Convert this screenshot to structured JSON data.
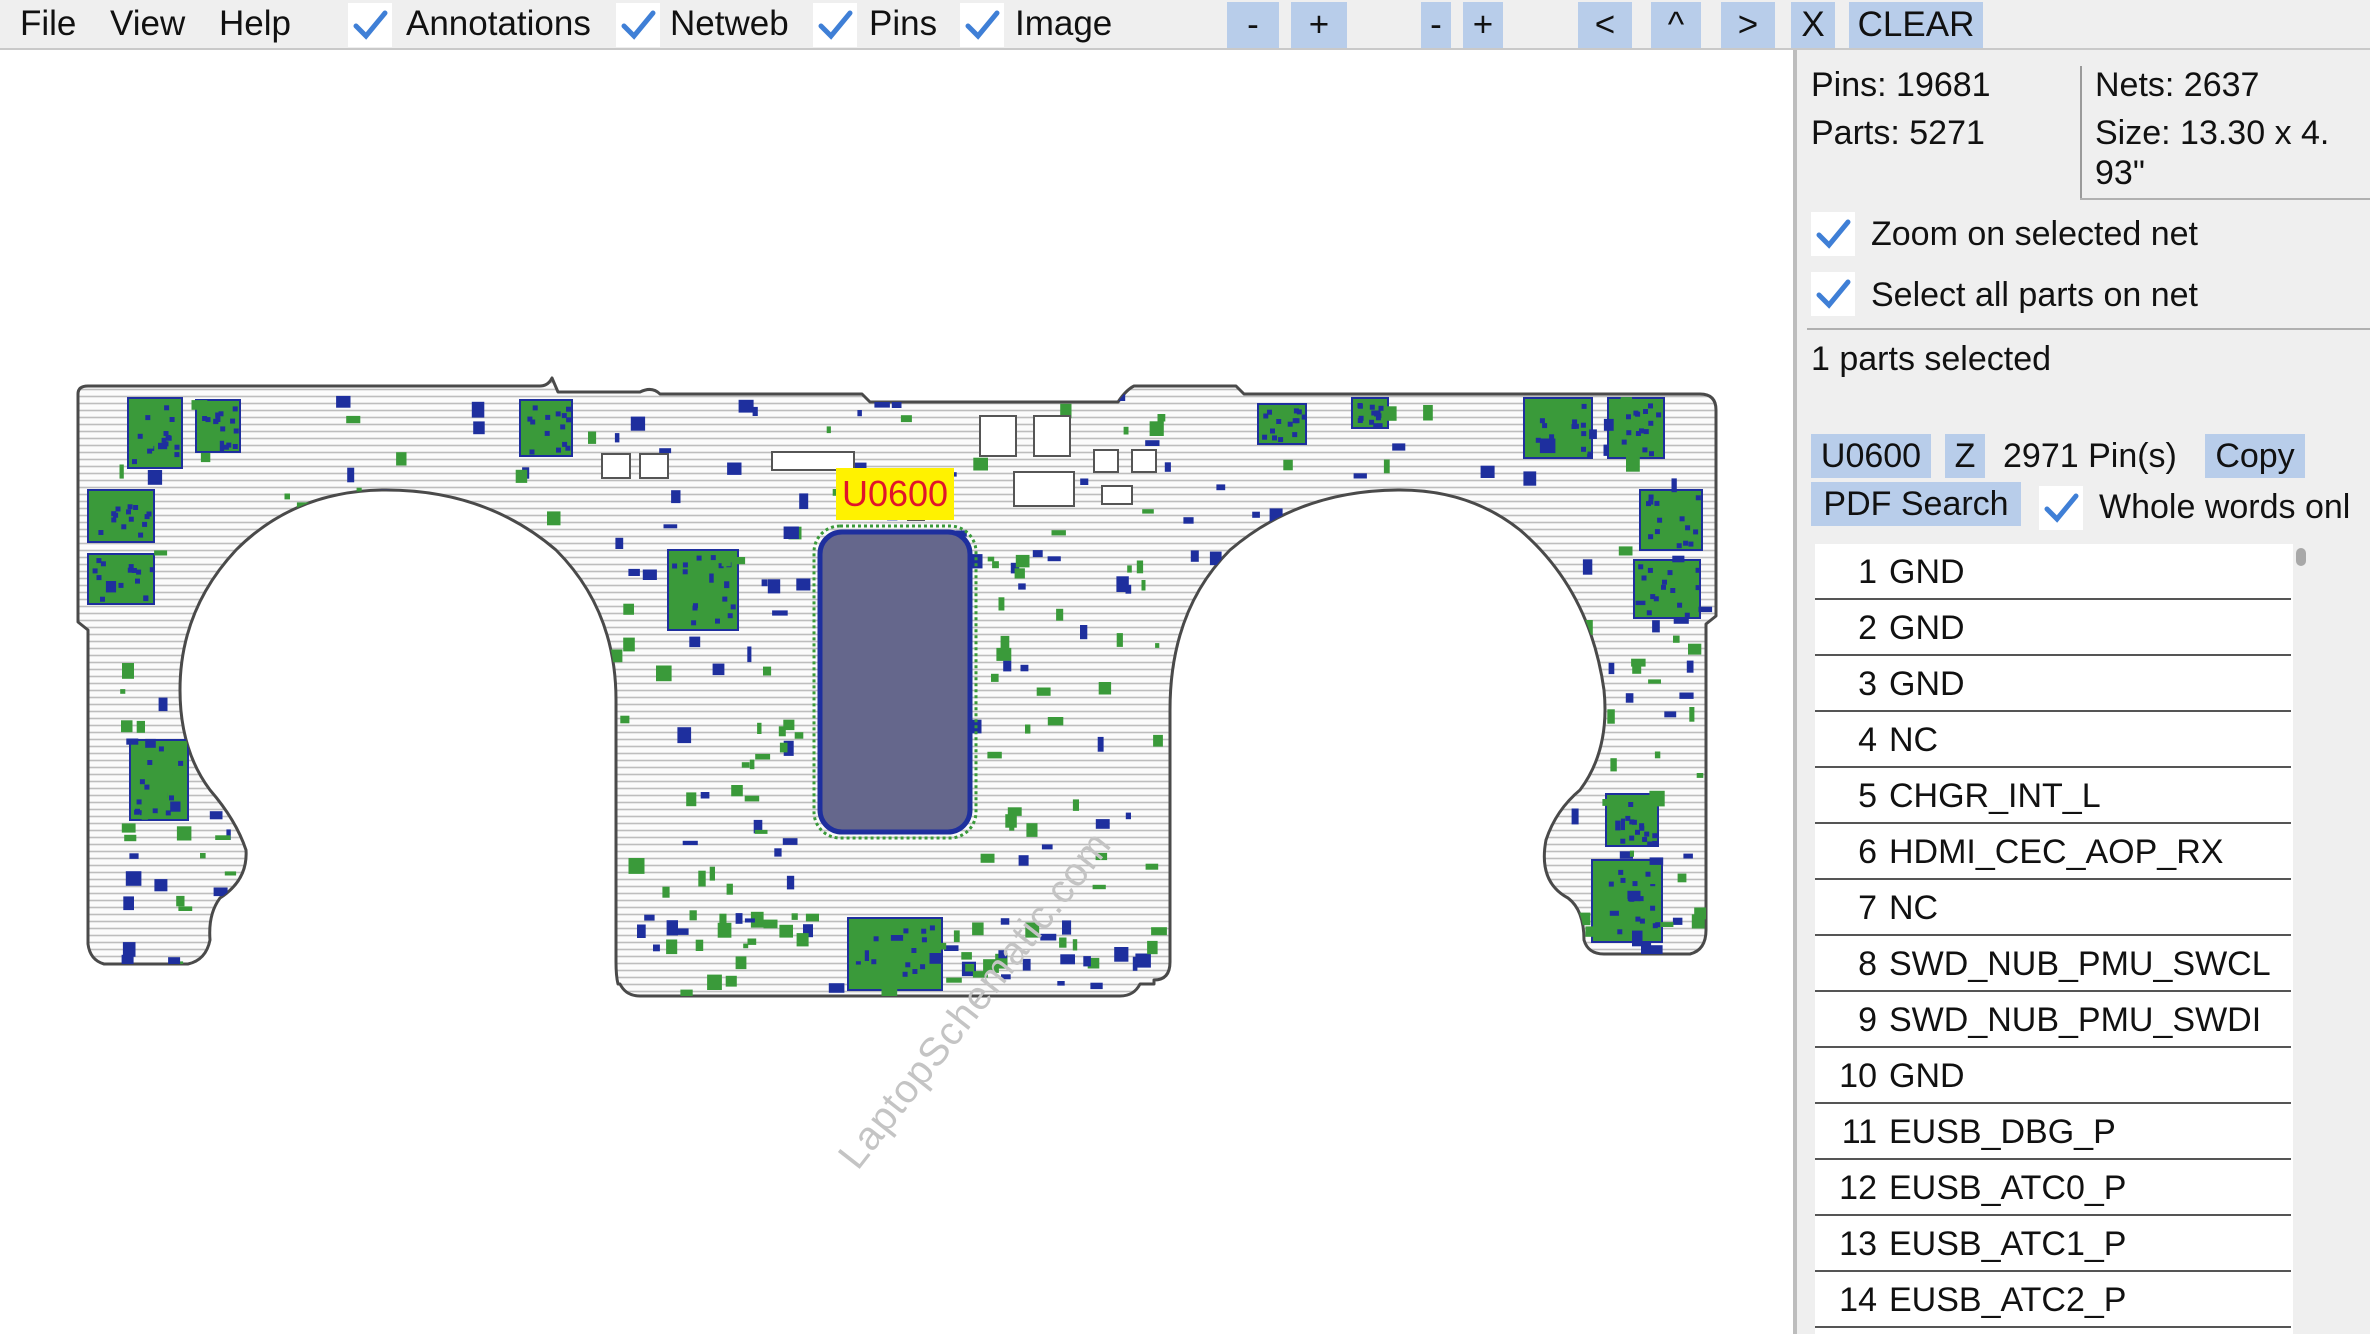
{
  "menu": {
    "file": "File",
    "view": "View",
    "help": "Help"
  },
  "toggles": [
    {
      "label": "Annotations",
      "checked": true
    },
    {
      "label": "Netweb",
      "checked": true
    },
    {
      "label": "Pins",
      "checked": true
    },
    {
      "label": "Image",
      "checked": true
    }
  ],
  "toolbar": {
    "zoom_out_1": "-",
    "zoom_in_1": "+",
    "zoom_out_2": "-",
    "zoom_in_2": "+",
    "prev": "<",
    "up": "^",
    "next": ">",
    "close": "X",
    "clear": "CLEAR"
  },
  "board": {
    "selected_part_label": "U0600",
    "watermark": "LaptopSchematic.com"
  },
  "panel": {
    "pins": "Pins: 19681",
    "parts": "Parts: 5271",
    "nets": "Nets: 2637",
    "size_line1": "Size: 13.30 x 4.",
    "size_line2": "93\"",
    "zoom_on_net": {
      "label": "Zoom on selected net",
      "checked": true
    },
    "select_all_on_net": {
      "label": "Select all parts on net",
      "checked": true
    },
    "selection_status": "1 parts selected",
    "part_button": "U0600",
    "z_button": "Z",
    "pin_count": "2971 Pin(s)",
    "copy_button": "Copy",
    "pdf_search_button": "PDF Search",
    "whole_words": {
      "label": "Whole words onl",
      "checked": true
    }
  },
  "pin_list": [
    {
      "num": "1",
      "net": "GND"
    },
    {
      "num": "2",
      "net": "GND"
    },
    {
      "num": "3",
      "net": "GND"
    },
    {
      "num": "4",
      "net": "NC"
    },
    {
      "num": "5",
      "net": "CHGR_INT_L"
    },
    {
      "num": "6",
      "net": "HDMI_CEC_AOP_RX"
    },
    {
      "num": "7",
      "net": "NC"
    },
    {
      "num": "8",
      "net": "SWD_NUB_PMU_SWCL"
    },
    {
      "num": "9",
      "net": "SWD_NUB_PMU_SWDI"
    },
    {
      "num": "10",
      "net": "GND"
    },
    {
      "num": "11",
      "net": "EUSB_DBG_P"
    },
    {
      "num": "12",
      "net": "EUSB_ATC0_P"
    },
    {
      "num": "13",
      "net": "EUSB_ATC1_P"
    },
    {
      "num": "14",
      "net": "EUSB_ATC2_P"
    }
  ],
  "colors": {
    "toolbar_button": "#b8cdea",
    "check_mark": "#3f7fd6",
    "part_green": "#3a9a3a",
    "part_blue": "#1e2f9e",
    "chip_fill": "#65678c",
    "label_bg": "#fff200",
    "label_text": "#e0142a"
  }
}
